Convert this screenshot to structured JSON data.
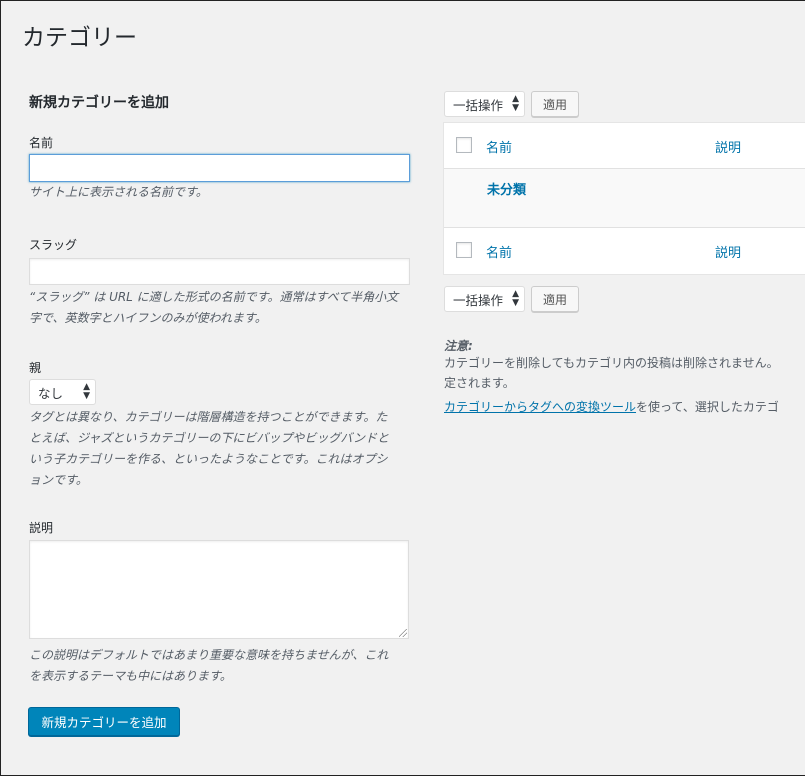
{
  "page": {
    "title": "カテゴリー"
  },
  "form": {
    "heading": "新規カテゴリーを追加",
    "name_label": "名前",
    "name_value": "",
    "name_desc": "サイト上に表示される名前です。",
    "slug_label": "スラッグ",
    "slug_value": "",
    "slug_desc_line1": "“スラッグ” は URL に適した形式の名前です。通常はすべて半角小文",
    "slug_desc_line2": "字で、英数字とハイフンのみが使われます。",
    "parent_label": "親",
    "parent_selected": "なし",
    "parent_desc_line1": "タグとは異なり、カテゴリーは階層構造を持つことができます。た",
    "parent_desc_line2": "とえば、ジャズというカテゴリーの下にビバップやビッグバンドと",
    "parent_desc_line3": "いう子カテゴリーを作る、といったようなことです。これはオプシ",
    "parent_desc_line4": "ョンです。",
    "description_label": "説明",
    "description_value": "",
    "description_desc_line1": "この説明はデフォルトではあまり重要な意味を持ちませんが、これ",
    "description_desc_line2": "を表示するテーマも中にはあります。",
    "submit_label": "新規カテゴリーを追加"
  },
  "bulk_top": {
    "selected": "一括操作",
    "apply_label": "適用"
  },
  "bulk_bottom": {
    "selected": "一括操作",
    "apply_label": "適用"
  },
  "table": {
    "columns": {
      "name": "名前",
      "description": "説明"
    },
    "rows": [
      {
        "name": "未分類"
      }
    ]
  },
  "note": {
    "title": "注意:",
    "line1": "カテゴリーを削除してもカテゴリ内の投稿は削除されません。",
    "line2": "定されます。",
    "link_text": "カテゴリーからタグへの変換ツール",
    "line3_rest": "を使って、選択したカテゴ"
  },
  "colors": {
    "accent": "#0085ba",
    "link": "#0073aa",
    "background": "#f1f1f1"
  }
}
